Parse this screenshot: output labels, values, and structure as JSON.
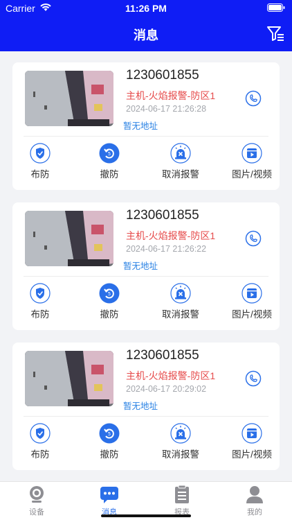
{
  "status_bar": {
    "carrier": "Carrier",
    "time": "11:26 PM"
  },
  "header": {
    "title": "消息",
    "filter_icon": "filter-icon"
  },
  "colors": {
    "header_bg": "#0f1df5",
    "alarm_red": "#e64a4a",
    "link_blue": "#2a82e4",
    "icon_blue": "#2a6fe8"
  },
  "messages": [
    {
      "device_id": "1230601855",
      "alarm": "主机-火焰报警-防区1",
      "time": "2024-06-17 21:26:28",
      "address": "暂无地址",
      "actions": {
        "arm": "布防",
        "disarm": "撤防",
        "cancel_alarm": "取消报警",
        "media": "图片/视频"
      }
    },
    {
      "device_id": "1230601855",
      "alarm": "主机-火焰报警-防区1",
      "time": "2024-06-17 21:26:22",
      "address": "暂无地址",
      "actions": {
        "arm": "布防",
        "disarm": "撤防",
        "cancel_alarm": "取消报警",
        "media": "图片/视频"
      }
    },
    {
      "device_id": "1230601855",
      "alarm": "主机-火焰报警-防区1",
      "time": "2024-06-17 20:29:02",
      "address": "暂无地址",
      "actions": {
        "arm": "布防",
        "disarm": "撤防",
        "cancel_alarm": "取消报警",
        "media": "图片/视频"
      }
    }
  ],
  "tabbar": {
    "items": [
      {
        "label": "设备",
        "icon": "camera-icon",
        "active": false
      },
      {
        "label": "消息",
        "icon": "chat-icon",
        "active": true
      },
      {
        "label": "报表",
        "icon": "report-icon",
        "active": false
      },
      {
        "label": "我的",
        "icon": "user-icon",
        "active": false
      }
    ]
  }
}
